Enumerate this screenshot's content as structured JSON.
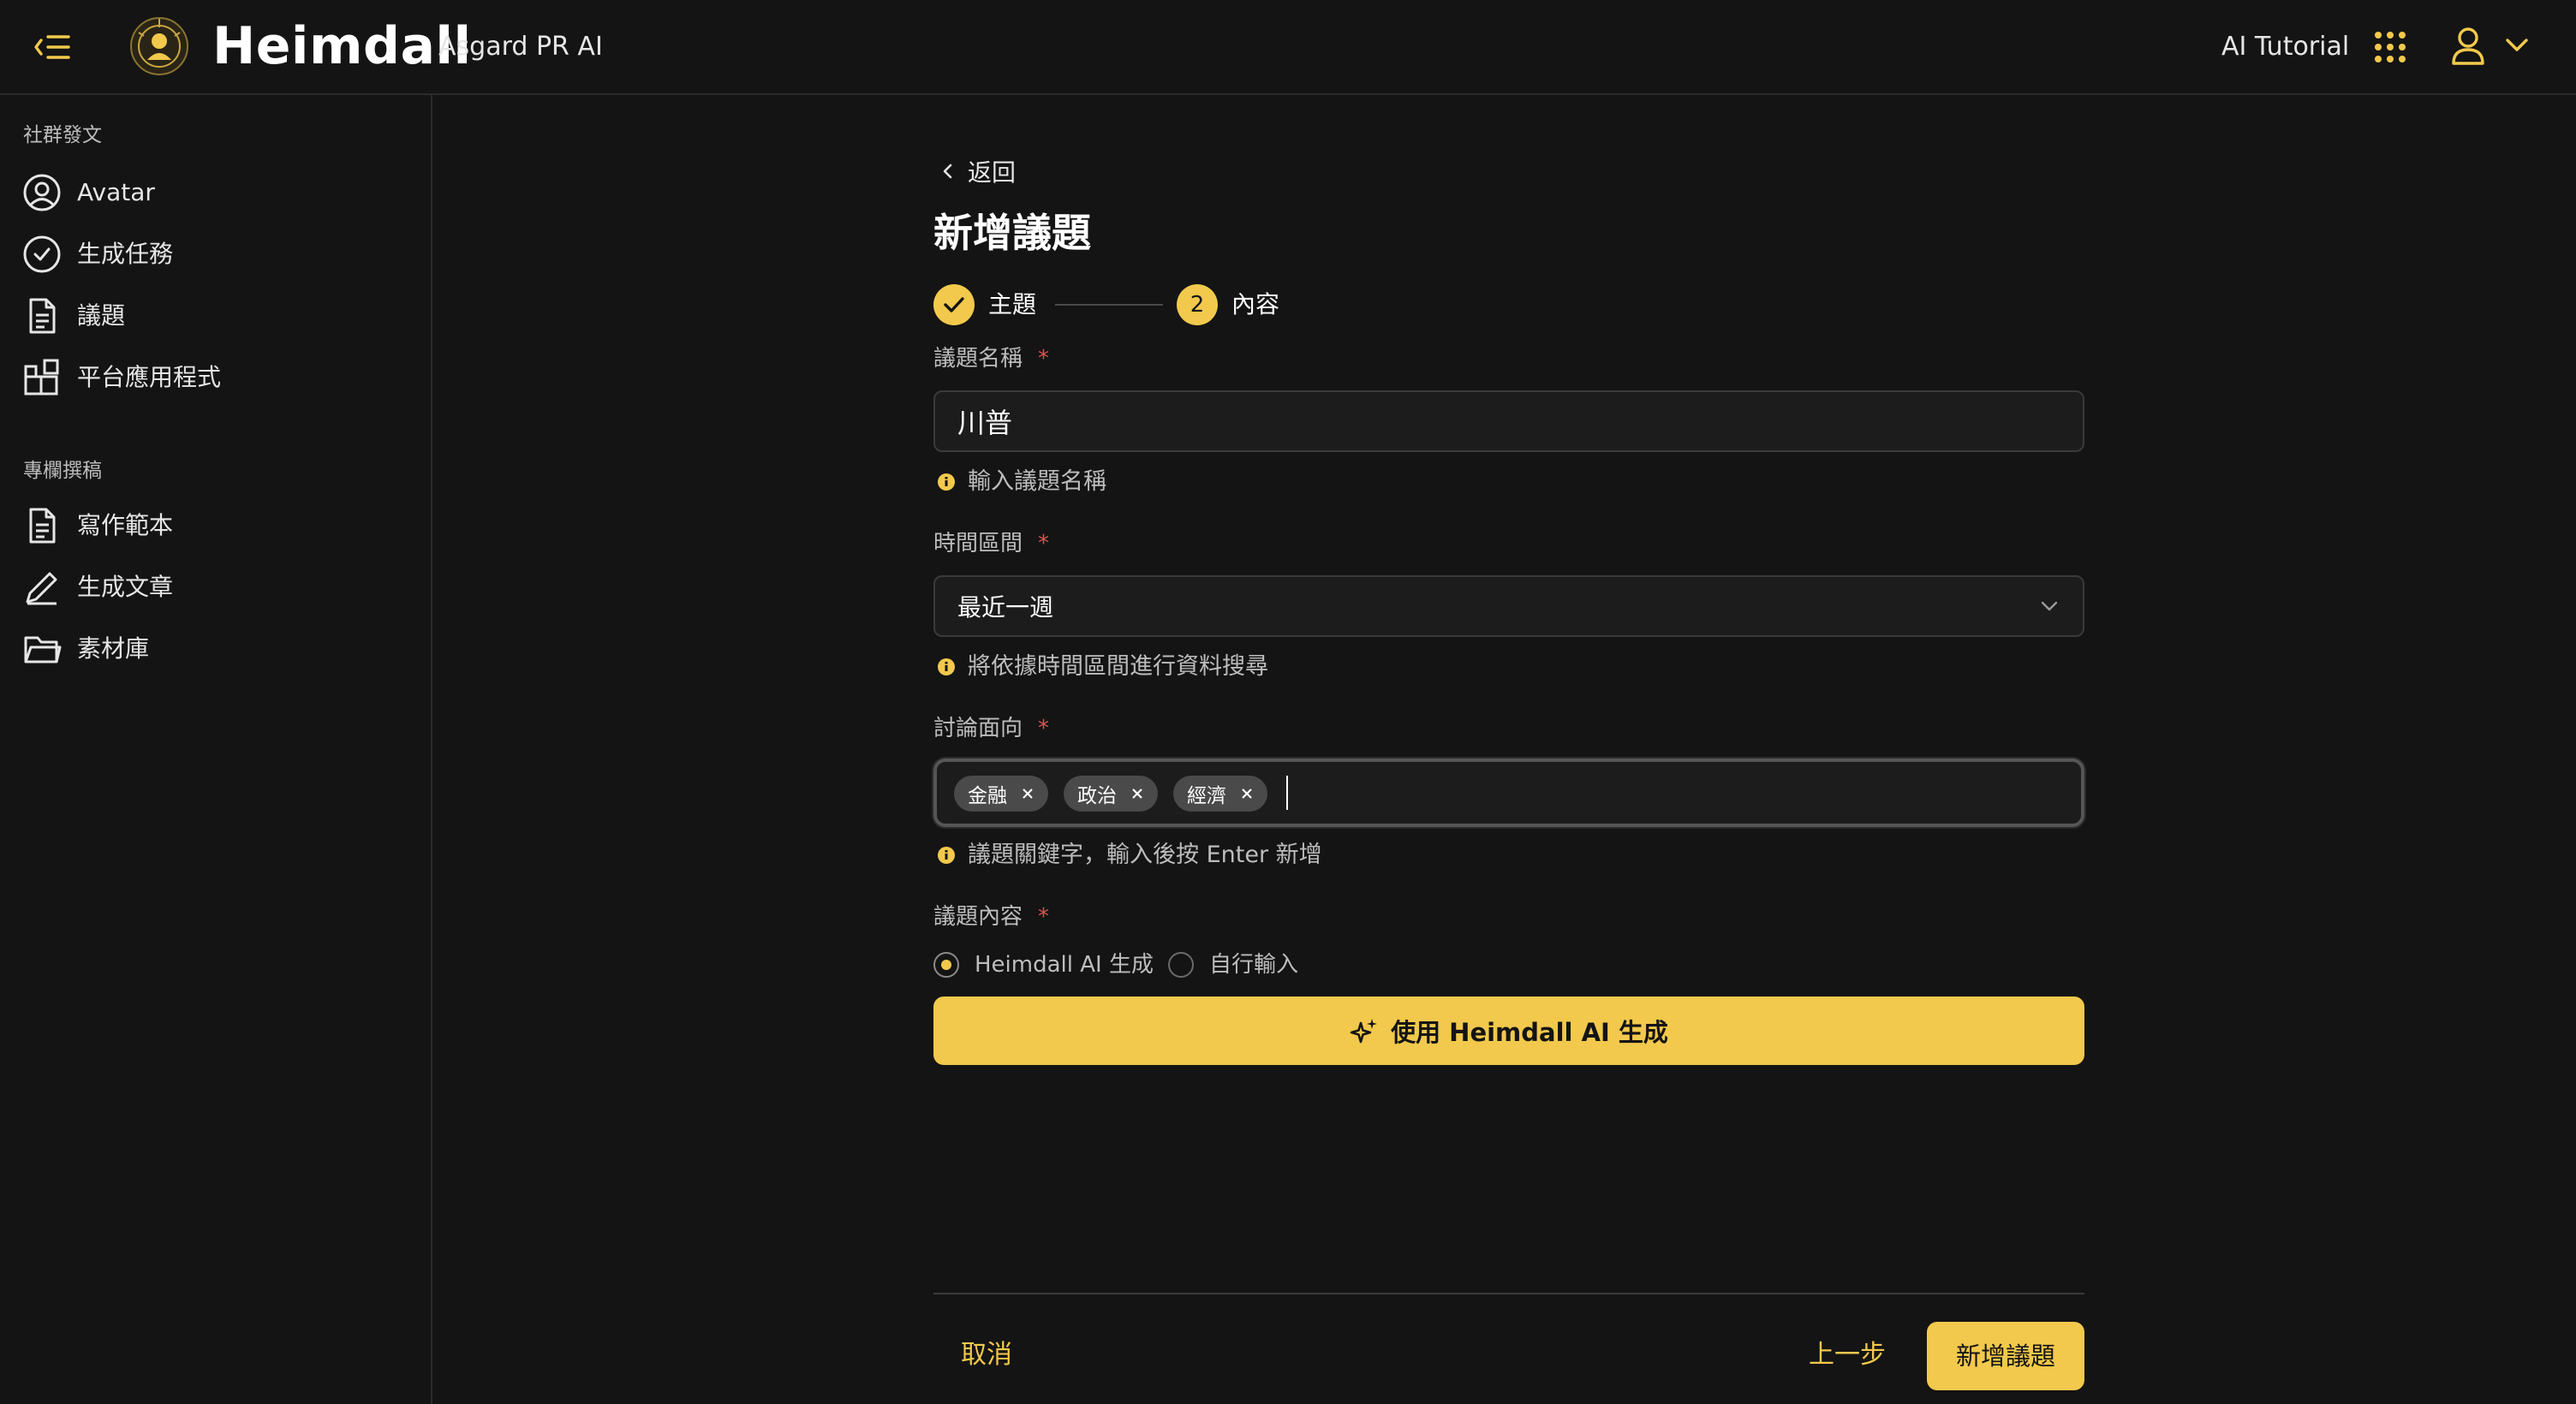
{
  "header": {
    "brand": "Heimdall",
    "sub_brand": "Asgard PR AI",
    "tutorial": "AI Tutorial"
  },
  "sidebar": {
    "section1": "社群發文",
    "items1": [
      {
        "label": "Avatar",
        "icon": "user-circle-icon"
      },
      {
        "label": "生成任務",
        "icon": "check-circle-icon"
      },
      {
        "label": "議題",
        "icon": "document-icon"
      },
      {
        "label": "平台應用程式",
        "icon": "apps-icon"
      }
    ],
    "section2": "專欄撰稿",
    "items2": [
      {
        "label": "寫作範本",
        "icon": "document-icon"
      },
      {
        "label": "生成文章",
        "icon": "pen-icon"
      },
      {
        "label": "素材庫",
        "icon": "folder-icon"
      }
    ]
  },
  "main": {
    "back": "返回",
    "title": "新增議題",
    "steps": [
      {
        "label": "主題",
        "state": "done"
      },
      {
        "number": "2",
        "label": "內容",
        "state": "current"
      }
    ],
    "name_field": {
      "label": "議題名稱",
      "required": "*",
      "value": "川普",
      "help": "輸入議題名稱"
    },
    "time_field": {
      "label": "時間區間",
      "required": "*",
      "value": "最近一週",
      "help": "將依據時間區間進行資料搜尋"
    },
    "aspect_field": {
      "label": "討論面向",
      "required": "*",
      "tags": [
        "金融",
        "政治",
        "經濟"
      ],
      "help": "議題關鍵字，輸入後按 Enter 新增"
    },
    "content_field": {
      "label": "議題內容",
      "required": "*",
      "options": [
        "Heimdall AI 生成",
        "自行輸入"
      ],
      "selected": "Heimdall AI 生成"
    },
    "generate_button": "使用 Heimdall AI 生成"
  },
  "footer": {
    "cancel": "取消",
    "prev": "上一步",
    "submit": "新增議題"
  },
  "colors": {
    "accent": "#f2c94c",
    "background": "#141414",
    "required": "#e05252"
  }
}
